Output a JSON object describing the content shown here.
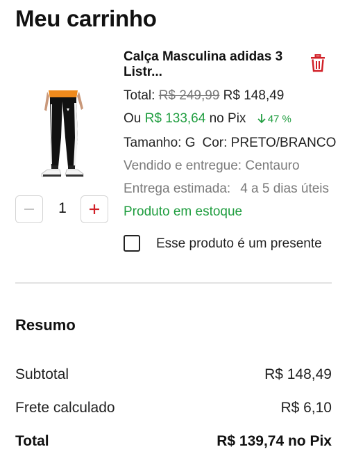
{
  "page": {
    "title": "Meu carrinho"
  },
  "product": {
    "name": "Calça Masculina adidas 3 Listr...",
    "total_label": "Total:",
    "old_price": "R$ 249,99",
    "price": "R$ 148,49",
    "pix_prefix": "Ou",
    "pix_price": "R$ 133,64",
    "pix_suffix": "no Pix",
    "discount": "47 %",
    "size_label": "Tamanho: G",
    "color_label": "Cor: PRETO/BRANCO",
    "seller": "Vendido e entregue: Centauro",
    "delivery_label": "Entrega estimada:",
    "delivery_value": "4 a 5 dias úteis",
    "stock": "Produto em estoque",
    "quantity": "1",
    "gift_label": "Esse produto é um presente",
    "gift_checked": false
  },
  "summary": {
    "title": "Resumo",
    "subtotal_label": "Subtotal",
    "subtotal_value": "R$ 148,49",
    "freight_label": "Frete calculado",
    "freight_value": "R$ 6,10",
    "total_label": "Total",
    "total_value": "R$ 139,74 no Pix"
  },
  "colors": {
    "accent_red": "#d11f26",
    "green": "#1f9d3f",
    "muted": "#7a7a7a"
  },
  "icons": {
    "trash": "trash-icon",
    "minus": "minus-icon",
    "plus": "plus-icon",
    "arrow_down": "arrow-down-icon"
  }
}
